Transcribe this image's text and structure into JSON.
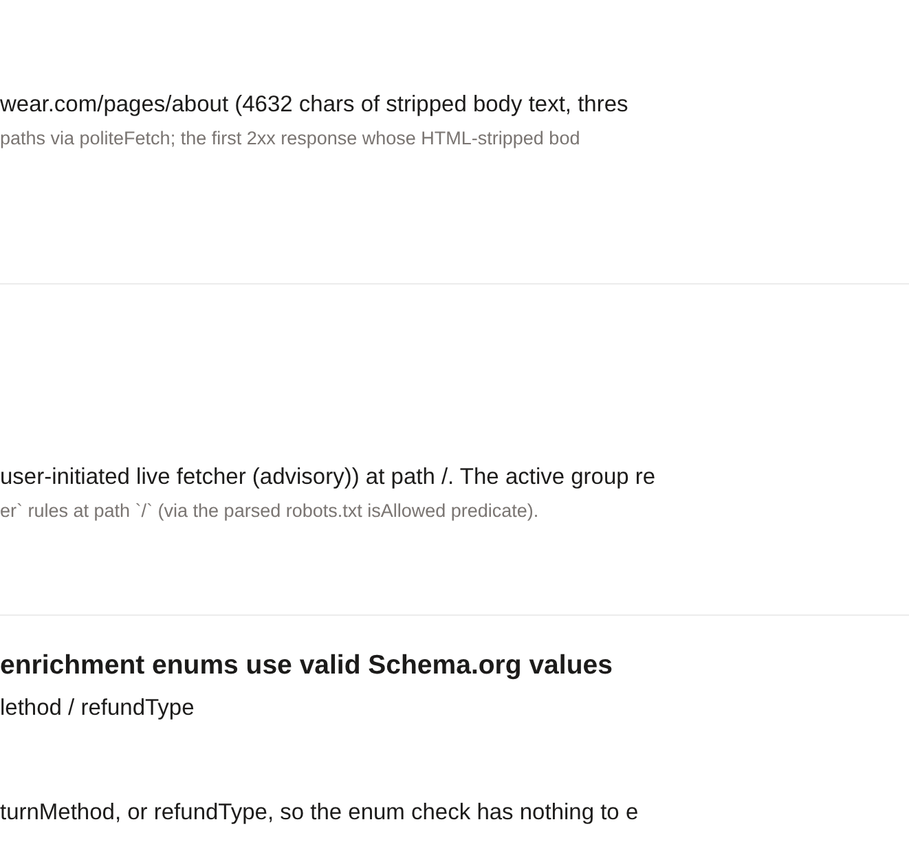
{
  "sections": [
    {
      "lines": [
        {
          "kind": "primary",
          "text": "wear.com/pages/about (4632 chars of stripped body text, thres"
        },
        {
          "kind": "secondary",
          "text": "paths via politeFetch; the first 2xx response whose HTML-stripped bod"
        }
      ]
    },
    {
      "lines": [
        {
          "kind": "primary",
          "text": "user-initiated live fetcher (advisory)) at path /. The active group re"
        },
        {
          "kind": "secondary",
          "text": "er` rules at path `/` (via the parsed robots.txt isAllowed predicate)."
        }
      ]
    },
    {
      "title": "enrichment enums use valid Schema.org values",
      "lines": [
        {
          "kind": "subtitle",
          "text": "lethod / refundType"
        },
        {
          "kind": "primary",
          "text": "turnMethod, or refundType, so the enum check has nothing to e"
        }
      ]
    }
  ]
}
